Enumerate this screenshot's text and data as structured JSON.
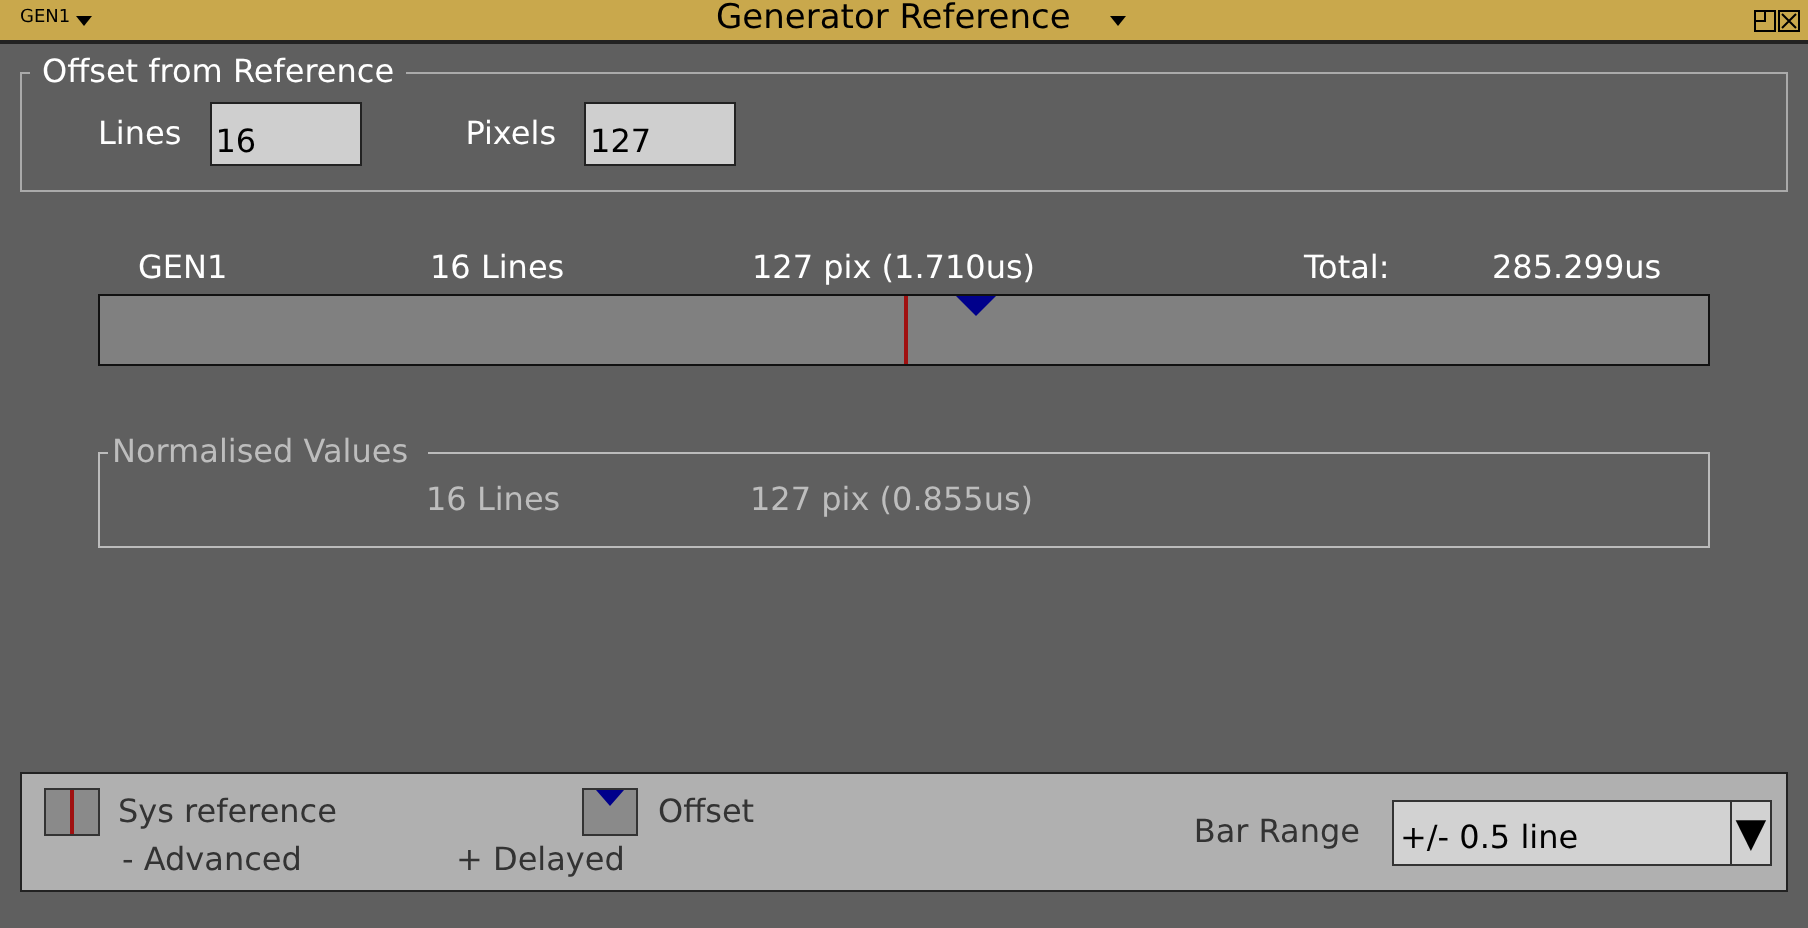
{
  "window": {
    "menu": "GEN1",
    "title": "Generator Reference"
  },
  "offset": {
    "legend": "Offset from Reference",
    "fields": [
      {
        "label": "Lines",
        "value": "16"
      },
      {
        "label": "Pixels",
        "value": "127"
      }
    ]
  },
  "summary": {
    "name": "GEN1",
    "lines": "16 Lines",
    "pixels": "127 pix (1.710us)",
    "total_label": "Total:",
    "total": "285.299us"
  },
  "bar": {
    "reference": {
      "level": 0.5
    },
    "offset": {
      "level": 0.545
    }
  },
  "normalised": {
    "legend": "Normalised Values",
    "lines": "16 Lines",
    "pixels": "127 pix (0.855us)"
  },
  "legend": {
    "reference": "Sys reference",
    "offset": "Offset",
    "advanced": "- Advanced",
    "delayed": "+ Delayed",
    "range_label": "Bar Range",
    "range": "+/- 0.5 line",
    "range_arrow": "▼"
  }
}
